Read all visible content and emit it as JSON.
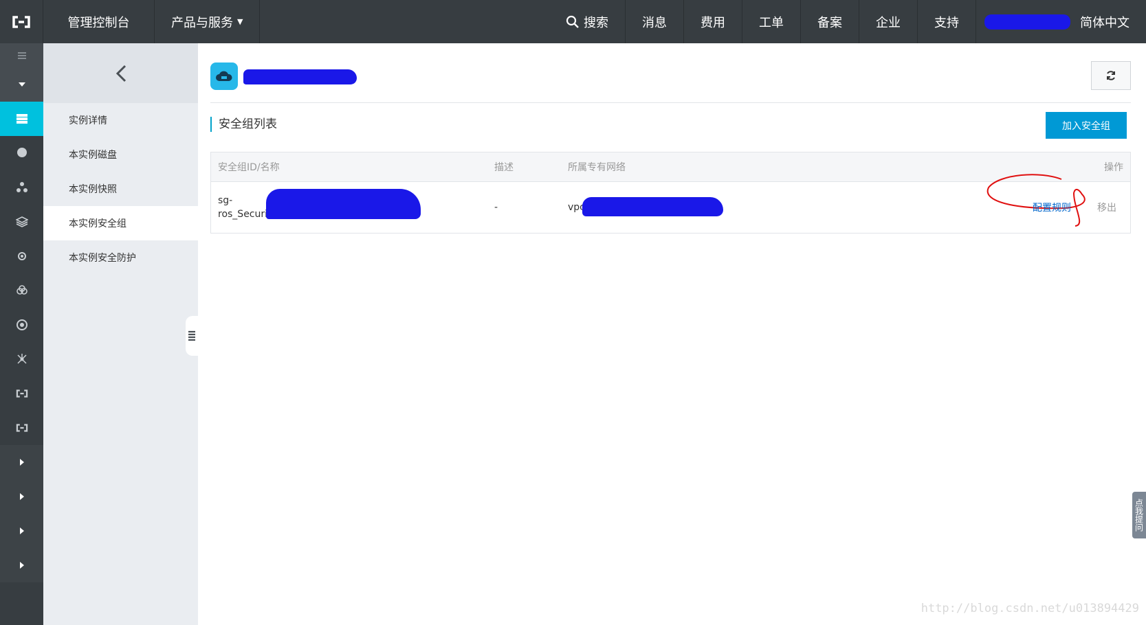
{
  "topbar": {
    "console": "管理控制台",
    "products": "产品与服务",
    "search": "搜索",
    "nav": [
      "消息",
      "费用",
      "工单",
      "备案",
      "企业",
      "支持"
    ],
    "language": "简体中文"
  },
  "subnav": {
    "items": [
      "实例详情",
      "本实例磁盘",
      "本实例快照",
      "本实例安全组",
      "本实例安全防护"
    ],
    "active_index": 3
  },
  "main": {
    "section_title": "安全组列表",
    "add_button": "加入安全组",
    "table": {
      "headers": [
        "安全组ID/名称",
        "描述",
        "所属专有网络",
        "操作"
      ],
      "rows": [
        {
          "id": "sg-",
          "name": "ros_Security",
          "description": "-",
          "vpc": "vpc-",
          "actions": [
            "配置规则",
            "移出"
          ]
        }
      ]
    }
  },
  "feedback_tab": "点我提问",
  "watermark": "http://blog.csdn.net/u013894429",
  "colors": {
    "topbar": "#373d41",
    "accent": "#00c1de",
    "primary_button": "#0099d5",
    "link": "#0066cc"
  }
}
